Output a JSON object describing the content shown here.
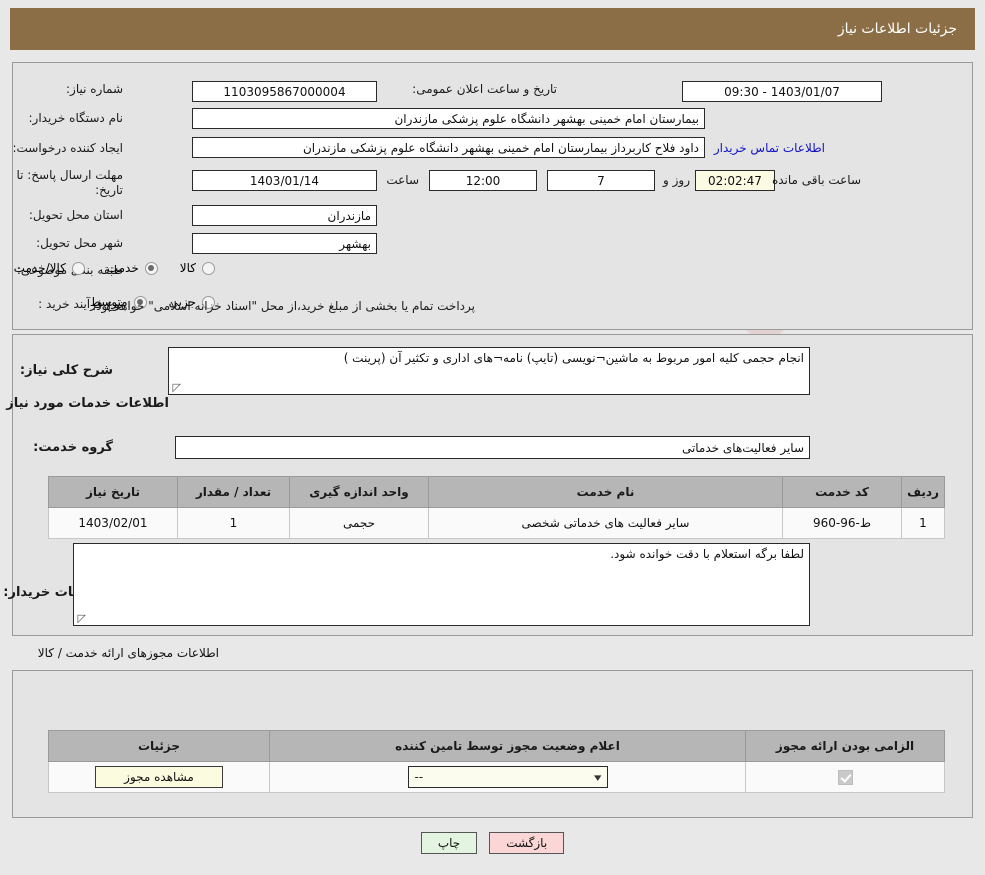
{
  "header": {
    "title": "جزئیات اطلاعات نیاز",
    "bg": "#8b6e46"
  },
  "top_panel": {
    "need_number_label": "شماره نیاز:",
    "need_number_value": "1103095867000004",
    "announce_label": "تاریخ و ساعت اعلان عمومی:",
    "announce_value": "1403/01/07 - 09:30",
    "buyer_org_label": "نام دستگاه خریدار:",
    "buyer_org_value": "بیمارستان امام خمینی بهشهر دانشگاه علوم پزشکی مازندران",
    "creator_label": "ایجاد کننده درخواست:",
    "creator_value": "داود فلاح کاربرداز بیمارستان امام خمینی بهشهر دانشگاه علوم پزشکی مازندران",
    "contact_link": "اطلاعات تماس خریدار",
    "deadline_label": "مهلت ارسال پاسخ: تا تاریخ:",
    "deadline_date": "1403/01/14",
    "hour_label": "ساعت",
    "hour_value": "12:00",
    "days_value": "7",
    "days_label": "روز و",
    "countdown_value": "02:02:47",
    "countdown_label": "ساعت باقی مانده",
    "province_label": "استان محل تحویل:",
    "province_value": "مازندران",
    "city_label": "شهر محل تحویل:",
    "city_value": "بهشهر",
    "category_label": "طبقه بندی موضوعی:",
    "category_options": [
      {
        "label": "کالا",
        "selected": false
      },
      {
        "label": "خدمت",
        "selected": true
      },
      {
        "label": "کالا/خدمت",
        "selected": false
      }
    ],
    "process_label": "نوع فرآیند خرید :",
    "process_options": [
      {
        "label": "جزیی",
        "selected": false
      },
      {
        "label": "متوسط",
        "selected": true
      }
    ],
    "process_note": "پرداخت تمام یا بخشی از مبلغ خرید،از محل \"اسناد خزانه اسلامی\" خواهد بود."
  },
  "middle_panel": {
    "general_desc_label": "شرح کلی نیاز:",
    "general_desc_value": "انجام حجمی کلیه امور مربوط به ماشین¬نویسی (تایپ) نامه¬های اداری و تکثیر آن (پرینت )",
    "services_info_title": "اطلاعات خدمات مورد نیاز",
    "service_group_label": "گروه خدمت:",
    "service_group_value": "سایر فعالیت‌های خدماتی",
    "table": {
      "headers": [
        "ردیف",
        "کد خدمت",
        "نام خدمت",
        "واحد اندازه گیری",
        "تعداد / مقدار",
        "تاریخ نیاز"
      ],
      "rows": [
        {
          "row": "1",
          "service_code": "ط-96-960",
          "service_name": "سایر فعالیت های خدماتی شخصی",
          "unit": "حجمی",
          "quantity": "1",
          "need_date": "1403/02/01"
        }
      ]
    },
    "buyer_notes_label": "توضیحات خریدار:",
    "buyer_notes_value": "لطفا برگه استعلام با دقت خوانده شود."
  },
  "permits": {
    "section_label": "اطلاعات مجوزهای ارائه خدمت / کالا",
    "headers": [
      "الزامی بودن ارائه مجوز",
      "اعلام وضعیت مجوز توسط تامین کننده",
      "جزئیات"
    ],
    "rows": [
      {
        "required_checked": true,
        "status_value": "--",
        "details_button": "مشاهده مجوز"
      }
    ]
  },
  "footer": {
    "back_label": "بازگشت",
    "print_label": "چاپ"
  },
  "watermark": {
    "text": "AriaTender.net"
  }
}
